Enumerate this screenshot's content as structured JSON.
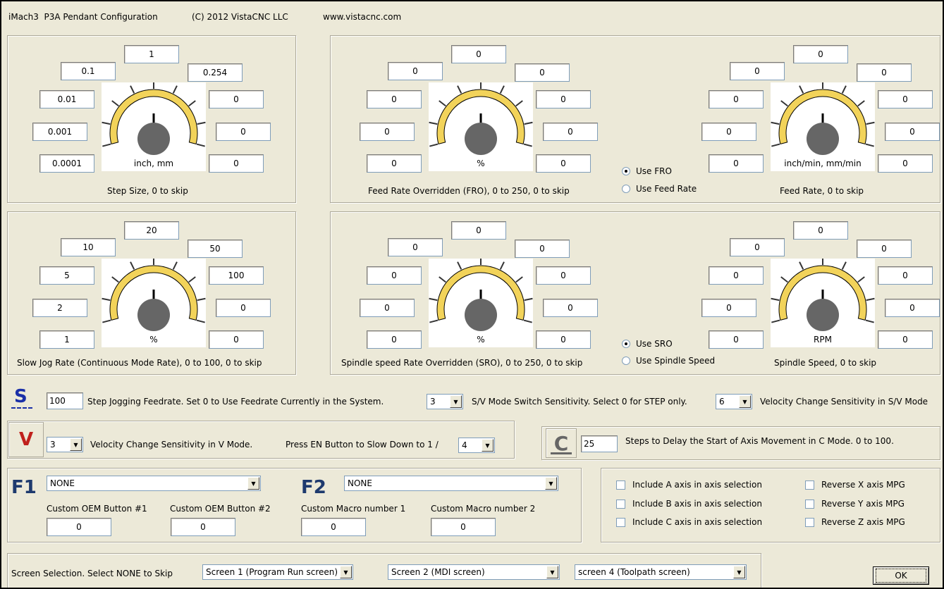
{
  "title": {
    "app": "iMach3",
    "config": "P3A Pendant Configuration",
    "copyright": "(C) 2012 VistaCNC LLC",
    "url": "www.vistacnc.com"
  },
  "step": {
    "values": [
      "1",
      "0.254",
      "0",
      "0",
      "0",
      "0.0001",
      "0.001",
      "0.01",
      "0.1"
    ],
    "unit": "inch, mm",
    "caption": "Step Size,  0 to skip"
  },
  "fro": {
    "values": [
      "0",
      "0",
      "0",
      "0",
      "0",
      "0",
      "0",
      "0",
      "0"
    ],
    "unit": "%",
    "caption": "Feed Rate Overridden (FRO), 0 to 250,  0 to skip"
  },
  "feedrate": {
    "values": [
      "0",
      "0",
      "0",
      "0",
      "0",
      "0",
      "0",
      "0",
      "0"
    ],
    "unit": "inch/min, mm/min",
    "caption": "Feed Rate, 0 to skip"
  },
  "fro_mode": {
    "opt1": "Use FRO",
    "opt2": "Use Feed Rate",
    "selected": "Use FRO"
  },
  "slowjog": {
    "values": [
      "20",
      "50",
      "100",
      "0",
      "0",
      "1",
      "2",
      "5",
      "10"
    ],
    "unit": "%",
    "caption": "Slow Jog Rate (Continuous Mode Rate), 0 to 100,  0 to skip"
  },
  "sro": {
    "values": [
      "0",
      "0",
      "0",
      "0",
      "0",
      "0",
      "0",
      "0",
      "0"
    ],
    "unit": "%",
    "caption": "Spindle speed Rate Overridden (SRO), 0 to 250,  0 to skip"
  },
  "spindle": {
    "values": [
      "0",
      "0",
      "0",
      "0",
      "0",
      "0",
      "0",
      "0",
      "0"
    ],
    "unit": "RPM",
    "caption": "Spindle Speed, 0 to skip"
  },
  "sro_mode": {
    "opt1": "Use SRO",
    "opt2": "Use Spindle Speed",
    "selected": "Use SRO"
  },
  "s_row": {
    "icon": "S",
    "feed_value": "100",
    "feed_label": "Step Jogging Feedrate. Set 0 to Use Feedrate Currently in the System.",
    "sv_value": "3",
    "sv_label": "S/V Mode Switch Sensitivity. Select 0 for STEP only.",
    "vel_value": "6",
    "vel_label": "Velocity Change Sensitivity in S/V Mode"
  },
  "v_row": {
    "icon": "V",
    "vel_value": "3",
    "vel_label": "Velocity Change Sensitivity in V Mode.",
    "en_label": "Press EN Button to Slow Down to 1 /",
    "en_value": "4"
  },
  "c_row": {
    "icon": "C",
    "delay_value": "25",
    "delay_label": "Steps to Delay the Start of Axis Movement in C Mode.  0 to 100."
  },
  "f1": {
    "icon": "F1",
    "value": "NONE"
  },
  "f2": {
    "icon": "F2",
    "value": "NONE"
  },
  "custom": {
    "oem1_label": "Custom OEM Button #1",
    "oem2_label": "Custom OEM Button #2",
    "macro1_label": "Custom Macro number 1",
    "macro2_label": "Custom Macro number 2",
    "oem1": "0",
    "oem2": "0",
    "macro1": "0",
    "macro2": "0"
  },
  "checks": {
    "a": "Include A axis in axis selection",
    "b": "Include B axis in axis selection",
    "c": "Include C axis in axis selection",
    "rx": "Reverse X axis MPG",
    "ry": "Reverse Y axis MPG",
    "rz": "Reverse Z axis MPG"
  },
  "screens": {
    "label": "Screen Selection. Select NONE to Skip",
    "s1": "Screen 1 (Program Run screen)",
    "s2": "Screen 2 (MDI screen)",
    "s3": "screen 4 (Toolpath screen)"
  },
  "ok_label": "OK",
  "colors": {
    "dial_arc": "#f2d35a",
    "knob": "#666666",
    "s_icon": "#1a2fa8",
    "v_icon": "#c0201c",
    "face": "#ece9d8"
  }
}
